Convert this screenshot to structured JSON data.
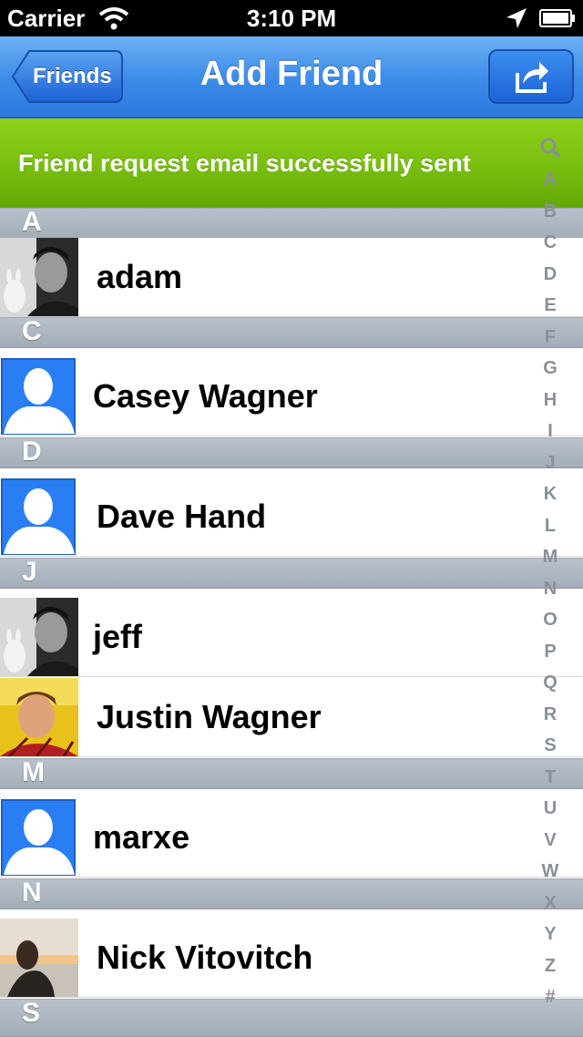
{
  "status": {
    "carrier": "Carrier",
    "time": "3:10 PM"
  },
  "nav": {
    "back_label": "Friends",
    "title": "Add Friend"
  },
  "banner": {
    "text": "Friend request email successfully sent"
  },
  "list": {
    "sections": [
      "A",
      "C",
      "D",
      "J",
      "M",
      "N",
      "S"
    ],
    "rows": [
      "adam",
      "Casey Wagner",
      "Dave Hand",
      "jeff",
      "Justin Wagner",
      "marxe",
      "Nick Vitovitch"
    ]
  },
  "index": [
    "A",
    "B",
    "C",
    "D",
    "E",
    "F",
    "G",
    "H",
    "I",
    "J",
    "K",
    "L",
    "M",
    "N",
    "O",
    "P",
    "Q",
    "R",
    "S",
    "T",
    "U",
    "V",
    "W",
    "X",
    "Y",
    "Z",
    "#"
  ],
  "colors": {
    "nav_blue": "#3e8de9",
    "banner_green": "#7ac010",
    "placeholder_blue": "#2a7ef3"
  }
}
